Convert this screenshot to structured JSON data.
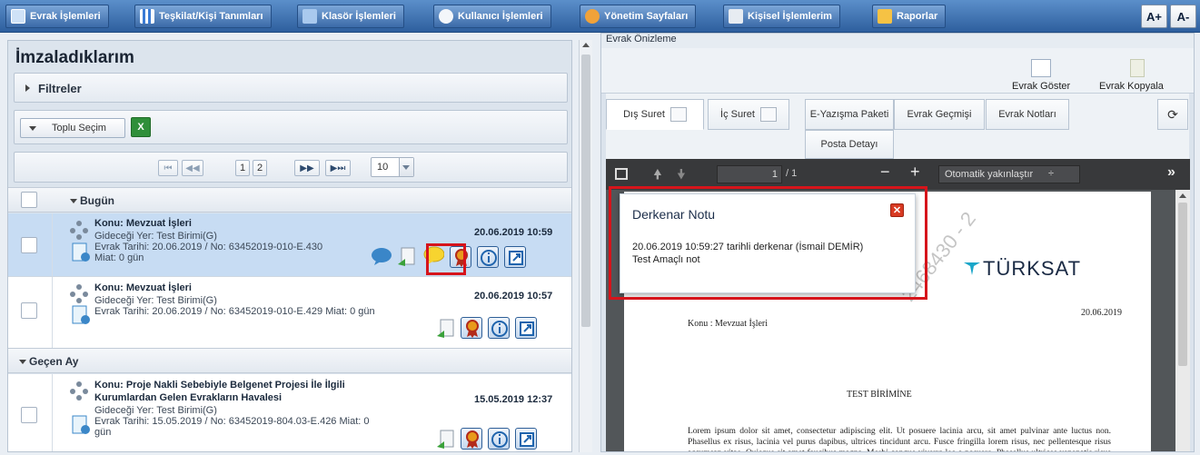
{
  "menu": {
    "evrak": "Evrak İşlemleri",
    "teskilat": "Teşkilat/Kişi Tanımları",
    "klasor": "Klasör İşlemleri",
    "kullanici": "Kullanıcı İşlemleri",
    "yonetim": "Yönetim Sayfaları",
    "kisisel": "Kişisel İşlemlerim",
    "raporlar": "Raporlar",
    "font_up": "A+",
    "font_down": "A-"
  },
  "left": {
    "title": "İmzaladıklarım",
    "filters": "Filtreler",
    "bulk_select": "Toplu Seçim",
    "pager": {
      "first": "⏮",
      "prev": "◀◀",
      "pages": [
        "1",
        "2"
      ],
      "next": "▶▶",
      "last": "▶⏭",
      "page_size": "10"
    },
    "groups": {
      "today": "Bugün",
      "last_month": "Geçen Ay"
    },
    "rows": [
      {
        "subject": "Konu: Mevzuat İşleri",
        "destination": "Gideceği Yer: Test Birimi(G)",
        "info": "Evrak Tarihi: 20.06.2019 / No: 63452019-010-E.430",
        "info2": "Miat: 0 gün",
        "datetime": "20.06.2019 10:59"
      },
      {
        "subject": "Konu: Mevzuat İşleri",
        "destination": "Gideceği Yer: Test Birimi(G)",
        "info": "Evrak Tarihi: 20.06.2019 / No: 63452019-010-E.429 Miat: 0 gün",
        "info2": "",
        "datetime": "20.06.2019 10:57"
      },
      {
        "subject": "Konu: Proje Nakli Sebebiyle Belgenet Projesi İle İlgili",
        "subject2": "Kurumlardan Gelen Evrakların Havalesi",
        "destination": "Gideceği Yer: Test Birimi(G)",
        "info": "Evrak Tarihi: 15.05.2019 / No: 63452019-804.03-E.426 Miat: 0",
        "info2": "gün",
        "datetime": "15.05.2019 12:37"
      }
    ]
  },
  "right": {
    "header": "Evrak Önizleme",
    "show_doc": "Evrak Göster",
    "copy_doc": "Evrak Kopyala",
    "tabs": [
      "Dış Suret",
      "İç Suret",
      "E-Yazışma Paketi",
      "Evrak Geçmişi",
      "Evrak Notları",
      "Posta Detayı"
    ],
    "pdf": {
      "page": "1",
      "page_total": "/ 1",
      "zoom": "Otomatik yakınlaştır",
      "logo": "TÜRKSAT",
      "date": "20.06.2019",
      "konu": "Konu : Mevzuat İşleri",
      "recipient": "TEST BİRİMİNE",
      "body": "Lorem ipsum dolor sit amet, consectetur adipiscing elit. Ut posuere lacinia arcu, sit amet pulvinar ante luctus non. Phasellus ex risus, lacinia vel purus dapibus, ultrices tincidunt arcu. Fusce fringilla lorem risus, nec pellentesque risus accumsan vitae. Quisque sit amet faucibus magna. Morbi congue viverra leo a posuere. Phasellus ultrices venenatis risus eget vehicula.",
      "watermark": "2468430 - 2"
    },
    "note_popup": {
      "title": "Derkenar Notu",
      "line1": "20.06.2019 10:59:27 tarihli derkenar (İsmail DEMİR)",
      "line2": "Test Amaçlı not"
    }
  },
  "colors": {
    "menu_bar": "#2e5f9e",
    "highlight": "#d6141b",
    "selected_row": "#c7dcf3"
  }
}
